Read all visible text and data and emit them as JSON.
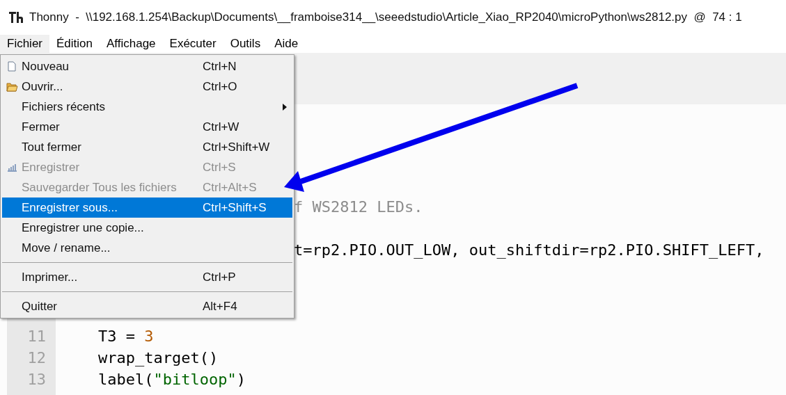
{
  "window": {
    "title": "Thonny  -  \\\\192.168.1.254\\Backup\\Documents\\__framboise314__\\seeedstudio\\Article_Xiao_RP2040\\microPython\\ws2812.py  @  74 : 1"
  },
  "menubar": [
    {
      "label": "Fichier",
      "selected": true
    },
    {
      "label": "Édition",
      "selected": false
    },
    {
      "label": "Affichage",
      "selected": false
    },
    {
      "label": "Exécuter",
      "selected": false
    },
    {
      "label": "Outils",
      "selected": false
    },
    {
      "label": "Aide",
      "selected": false
    }
  ],
  "menu": [
    {
      "kind": "item",
      "label": "Nouveau",
      "shortcut": "Ctrl+N",
      "disabled": false,
      "selected": false,
      "submenu": false
    },
    {
      "kind": "item",
      "label": "Ouvrir...",
      "shortcut": "Ctrl+O",
      "disabled": false,
      "selected": false,
      "submenu": false
    },
    {
      "kind": "item",
      "label": "Fichiers récents",
      "disabled": false,
      "selected": false,
      "submenu": true
    },
    {
      "kind": "item",
      "label": "Fermer",
      "shortcut": "Ctrl+W",
      "disabled": false,
      "selected": false,
      "submenu": false
    },
    {
      "kind": "item",
      "label": "Tout fermer",
      "shortcut": "Ctrl+Shift+W",
      "disabled": false,
      "selected": false,
      "submenu": false
    },
    {
      "kind": "item",
      "label": "Enregistrer",
      "shortcut": "Ctrl+S",
      "disabled": true,
      "selected": false,
      "submenu": false
    },
    {
      "kind": "item",
      "label": "Sauvegarder Tous les fichiers",
      "shortcut": "Ctrl+Alt+S",
      "disabled": true,
      "selected": false,
      "submenu": false
    },
    {
      "kind": "item",
      "label": "Enregistrer sous...",
      "shortcut": "Ctrl+Shift+S",
      "disabled": false,
      "selected": true,
      "submenu": false
    },
    {
      "kind": "item",
      "label": "Enregistrer une copie...",
      "disabled": false,
      "selected": false,
      "submenu": false
    },
    {
      "kind": "item",
      "label": "Move / rename...",
      "disabled": false,
      "selected": false,
      "submenu": false
    },
    {
      "kind": "separator"
    },
    {
      "kind": "item",
      "label": "Imprimer...",
      "shortcut": "Ctrl+P",
      "disabled": false,
      "selected": false,
      "submenu": false
    },
    {
      "kind": "separator"
    },
    {
      "kind": "item",
      "label": "Quitter",
      "shortcut": "Alt+F4",
      "disabled": false,
      "selected": false,
      "submenu": false
    }
  ],
  "editor": {
    "lines": [
      {
        "segments": [
          {
            "kind": "comment",
            "text": "f WS2812 LEDs."
          }
        ]
      },
      {
        "segments": [
          {
            "kind": "plain",
            "text": "t=rp2.PIO.OUT_LOW, out_shiftdir=rp2.PIO.SHIFT_LEFT,"
          }
        ]
      },
      {
        "number": "11",
        "segments": [
          {
            "kind": "plain",
            "text": "    T3 = "
          },
          {
            "kind": "number",
            "text": "3"
          }
        ]
      },
      {
        "number": "12",
        "segments": [
          {
            "kind": "plain",
            "text": "    wrap_target()"
          }
        ]
      },
      {
        "number": "13",
        "segments": [
          {
            "kind": "plain",
            "text": "    label("
          },
          {
            "kind": "string",
            "text": "\"bitloop\""
          },
          {
            "kind": "plain",
            "text": ")"
          }
        ]
      }
    ]
  }
}
